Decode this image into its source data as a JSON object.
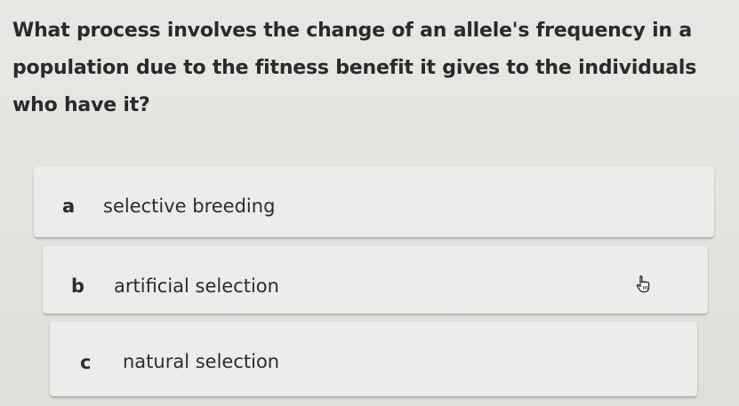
{
  "question": {
    "text": "What process involves the change of an allele's frequency in a population due to the fitness benefit it gives to the individuals who have it?"
  },
  "options": [
    {
      "letter": "a",
      "label": "selective breeding"
    },
    {
      "letter": "b",
      "label": "artificial selection"
    },
    {
      "letter": "c",
      "label": "natural selection"
    }
  ],
  "cursor": {
    "icon": "hand-pointer-icon"
  }
}
